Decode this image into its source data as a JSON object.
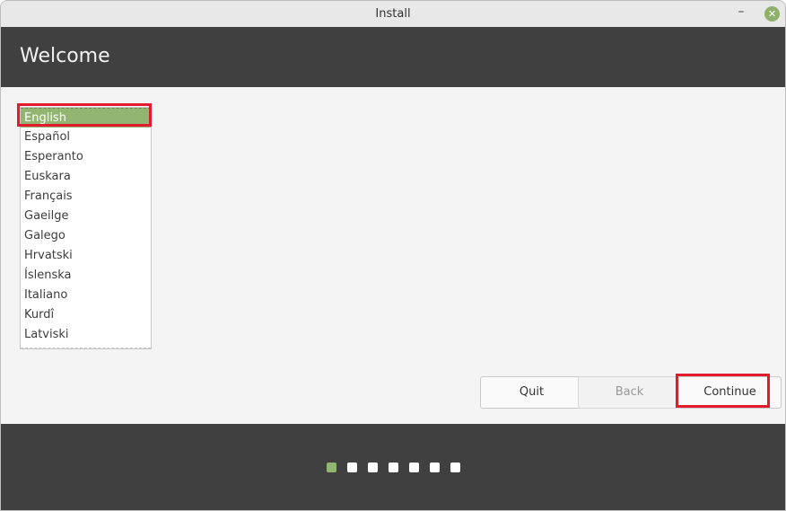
{
  "window": {
    "title": "Install",
    "minimize_icon": "minimize-icon",
    "close_icon": "close-icon",
    "minimize_glyph": "–",
    "close_glyph": "✕"
  },
  "header": {
    "title": "Welcome"
  },
  "languages": {
    "selected": "English",
    "items": [
      {
        "label": "English",
        "selected": true
      },
      {
        "label": "Español",
        "selected": false
      },
      {
        "label": "Esperanto",
        "selected": false
      },
      {
        "label": "Euskara",
        "selected": false
      },
      {
        "label": "Français",
        "selected": false
      },
      {
        "label": "Gaeilge",
        "selected": false
      },
      {
        "label": "Galego",
        "selected": false
      },
      {
        "label": "Hrvatski",
        "selected": false
      },
      {
        "label": "Íslenska",
        "selected": false
      },
      {
        "label": "Italiano",
        "selected": false
      },
      {
        "label": "Kurdî",
        "selected": false
      },
      {
        "label": "Latviski",
        "selected": false
      }
    ]
  },
  "buttons": {
    "quit": {
      "label": "Quit",
      "enabled": true
    },
    "back": {
      "label": "Back",
      "enabled": false
    },
    "continue": {
      "label": "Continue",
      "enabled": true
    }
  },
  "progress": {
    "total_steps": 7,
    "current_step": 1
  },
  "colors": {
    "accent": "#93b572",
    "highlight": "#e31b2e",
    "header_bg": "#404040"
  }
}
